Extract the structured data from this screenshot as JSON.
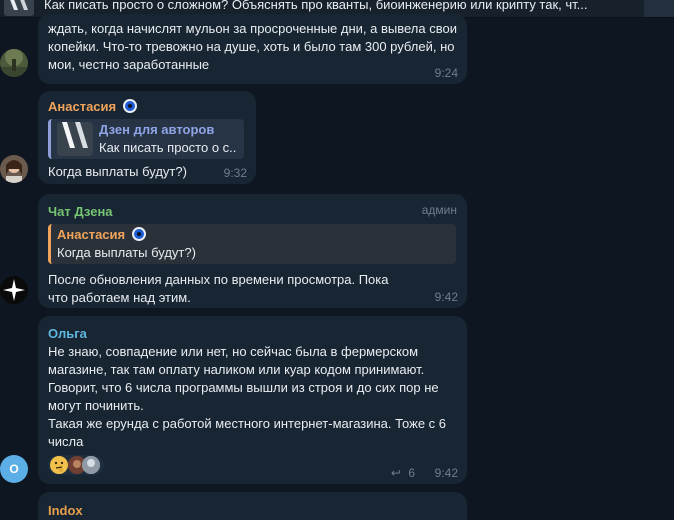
{
  "pinned": {
    "text": "Как писать просто о сложном?  Объяснять про кванты, биоинженерию или крипту так, чт..."
  },
  "messages": [
    {
      "id": "m1",
      "text": "ждать, когда начислят мульон за просроченные дни, а вывела свои копейки. Что-то тревожно на душе, хоть и было там 300 рублей, но мои, честно заработанные",
      "time": "9:24"
    },
    {
      "id": "m2",
      "sender": "Анастасия",
      "reply": {
        "title": "Дзен для авторов",
        "text": "Как писать просто о с..."
      },
      "text": "Когда выплаты будут?)",
      "time": "9:32"
    },
    {
      "id": "m3",
      "sender": "Чат Дзена",
      "role": "админ",
      "reply": {
        "title": "Анастасия",
        "text": "Когда выплаты будут?)"
      },
      "text": "После обновления данных по времени просмотра. Пока что работаем над этим.",
      "time": "9:42"
    },
    {
      "id": "m4",
      "sender": "Ольга",
      "avatar_letter": "О",
      "text": "Не знаю, совпадение или нет, но сейчас была в фермерском магазине, так там оплату наликом или куар кодом принимают. Говорит, что 6 числа программы вышли из строя и до сих пор не могут починить.\nТакая же ерунда с работой местного интернет-магазина. Тоже с 6 числа",
      "replies_count": "6",
      "time": "9:42",
      "reactions": [
        "thinking-face",
        "avatar",
        "avatar"
      ]
    },
    {
      "id": "m5",
      "sender": "Indox"
    }
  ],
  "colors": {
    "background": "#0e1621",
    "bubble": "#182533",
    "anastasia": "#f0a45b",
    "chat_dzen": "#76c572",
    "olga": "#5fb8e0",
    "indox": "#e6a04f",
    "timestamp": "#6d7f8f"
  }
}
